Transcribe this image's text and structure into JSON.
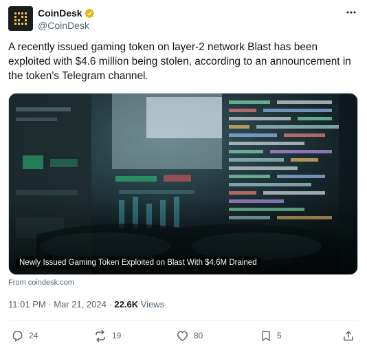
{
  "author": {
    "display_name": "CoinDesk",
    "handle": "@CoinDesk",
    "avatar_icon": "coindesk-logo-icon",
    "verified_icon": "verified-badge-icon",
    "verified_color": "#e2b719"
  },
  "tweet": {
    "text": "A recently issued gaming token on layer-2 network Blast has been exploited with $4.6 million being stolen, according to an announcement in the token's Telegram channel."
  },
  "card": {
    "caption": "Newly Issued Gaming Token Exploited on Blast With $4.6M Drained",
    "source": "From coindesk.com"
  },
  "meta": {
    "time": "11:01 PM",
    "separator1": " · ",
    "date": "Mar 21, 2024",
    "separator2": " · ",
    "views_count": "22.6K",
    "views_label": " Views"
  },
  "actions": {
    "reply_count": "24",
    "retweet_count": "19",
    "like_count": "80",
    "bookmark_count": "5"
  },
  "colors": {
    "text_primary": "#0f1419",
    "text_secondary": "#536471",
    "border": "#cfd9de"
  }
}
